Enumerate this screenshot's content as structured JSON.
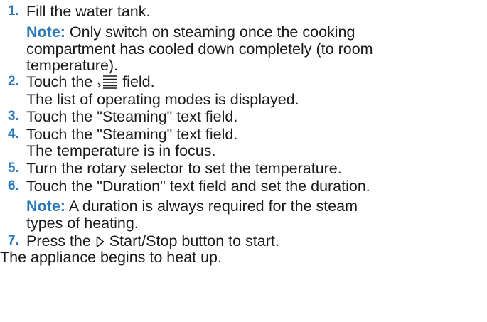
{
  "steps": [
    {
      "number": "1.",
      "text": "Fill the water tank.",
      "note_label": "Note:",
      "note_lines": [
        "Only switch on steaming once the cooking",
        "compartment has cooled down completely (to room",
        "temperature)."
      ]
    },
    {
      "number": "2.",
      "text_before_icon": "Touch the",
      "icon": "menu-list-icon",
      "text_after_icon": "field.",
      "result": "The list of operating modes is displayed."
    },
    {
      "number": "3.",
      "text": "Touch the \"Steaming\" text field."
    },
    {
      "number": "4.",
      "text": "Touch the \"Steaming\" text field.",
      "result": "The temperature is in focus."
    },
    {
      "number": "5.",
      "text": "Turn the rotary selector to set the temperature."
    },
    {
      "number": "6.",
      "text": "Touch the \"Duration\" text field and set the duration.",
      "note_label": "Note:",
      "note_lines": [
        "A duration is always required for the steam",
        "types of heating."
      ]
    },
    {
      "number": "7.",
      "text_before_icon": "Press the",
      "icon": "start-stop-icon",
      "text_after_icon": "Start/Stop button to start."
    }
  ],
  "final_result": "The appliance begins to heat up.",
  "colors": {
    "accent": "#2a78b8",
    "text": "#1a1a1a"
  }
}
